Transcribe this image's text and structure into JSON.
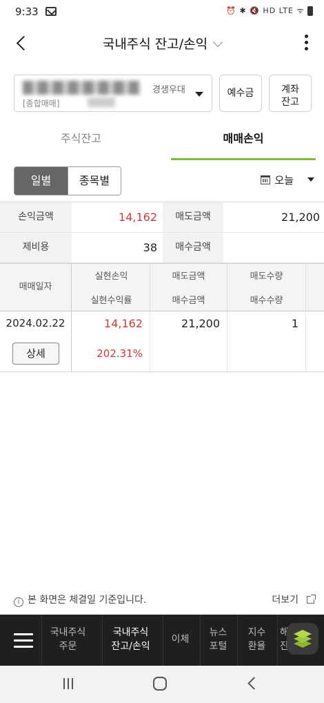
{
  "status_bar": {
    "time": "9:33",
    "right_icons": "⏰ ✱ 🔇 HD LTE ᯤ"
  },
  "header": {
    "title": "국내주식 잔고/손익"
  },
  "account": {
    "owner_suffix": "경생우대",
    "type": "[종합매매]"
  },
  "buttons": {
    "deposit": "예수금",
    "account_balance_line1": "계좌",
    "account_balance_line2": "잔고"
  },
  "tabs": {
    "stock_balance": "주식잔고",
    "trade_pnl": "매매손익"
  },
  "toggle": {
    "daily": "일별",
    "by_item": "종목별"
  },
  "date_filter": {
    "label": "오늘"
  },
  "summary": {
    "pnl_amount_label": "손익금액",
    "pnl_amount_value": "14,162",
    "sell_amount_label": "매도금액",
    "sell_amount_value": "21,200",
    "fees_label": "제비용",
    "fees_value": "38",
    "buy_amount_label": "매수금액",
    "buy_amount_value": ""
  },
  "table": {
    "headers": {
      "trade_date": "매매일자",
      "realized_pnl": "실현손익",
      "realized_return": "실현수익률",
      "sell_amount": "매도금액",
      "buy_amount": "매수금액",
      "sell_qty": "매도수량",
      "buy_qty": "매수수량"
    },
    "rows": [
      {
        "date": "2024.02.22",
        "detail": "상세",
        "realized_pnl": "14,162",
        "realized_return": "202.31%",
        "sell_amount": "21,200",
        "buy_amount": "",
        "sell_qty": "1",
        "buy_qty": ""
      }
    ]
  },
  "footer": {
    "note": "본 화면은 체결일 기준입니다.",
    "more": "더보기"
  },
  "bottom_nav": {
    "item1_l1": "국내주식",
    "item1_l2": "주문",
    "item2_l1": "국내주식",
    "item2_l2": "잔고/손익",
    "item3": "이체",
    "item4_l1": "뉴스",
    "item4_l2": "포털",
    "item5_l1": "지수",
    "item5_l2": "환율",
    "item6_l1": "해",
    "item6_l2": "잔"
  },
  "colors": {
    "accent_green": "#7cbf3c",
    "profit_red": "#d33a3a",
    "nav_bg": "#1f1f1f"
  }
}
